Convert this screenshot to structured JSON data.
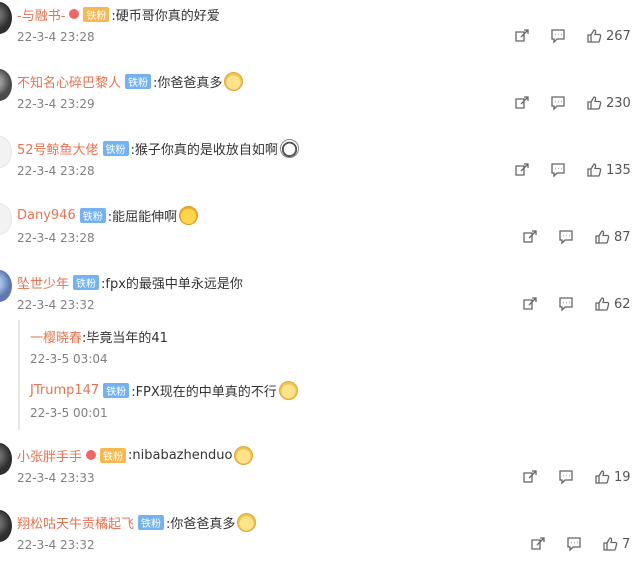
{
  "colors": {
    "username": "#eb7350",
    "badge": "#75b2f3",
    "time": "#808080",
    "text": "#333333"
  },
  "icons": {
    "repost": "repost-icon",
    "comment": "comment-icon",
    "like": "like-icon"
  },
  "comments": [
    {
      "user": "-与融书-",
      "badge": "铁粉",
      "text": ":硬币哥你真的好爱",
      "emoji": "",
      "time": "22-3-4 23:28",
      "likes": "267"
    },
    {
      "user": "不知名心碎巴黎人",
      "badge": "铁粉",
      "text": ":你爸爸真多",
      "emoji": "cat-emoji",
      "time": "22-3-4 23:29",
      "likes": "230"
    },
    {
      "user": "52号鲸鱼大佬",
      "badge": "铁粉",
      "text": ":猴子你真的是收放自如啊",
      "emoji": "dog-emoji",
      "time": "22-3-4 23:28",
      "likes": "135"
    },
    {
      "user": "Dany946",
      "badge": "铁粉",
      "text": ":能屈能伸啊",
      "emoji": "laugh-emoji",
      "time": "22-3-4 23:28",
      "likes": "87"
    },
    {
      "user": "坠世少年",
      "badge": "铁粉",
      "text": ":fpx的最强中单永远是你",
      "emoji": "",
      "time": "22-3-4 23:32",
      "likes": "62"
    },
    {
      "user": "小张胖手手",
      "badge": "铁粉",
      "text": ":nibabazhenduo",
      "emoji": "cat-emoji",
      "time": "22-3-4 23:33",
      "likes": "19"
    },
    {
      "user": "翔松咕天牛贡橘起飞",
      "badge": "铁粉",
      "text": ":你爸爸真多",
      "emoji": "cat-emoji",
      "time": "22-3-4 23:32",
      "likes": "7"
    }
  ],
  "replies": [
    {
      "user": "一樱晓春",
      "badge": "",
      "text": ":毕竟当年的41",
      "emoji": "",
      "time": "22-3-5 03:04"
    },
    {
      "user": "JTrump147",
      "badge": "铁粉",
      "text": ":FPX现在的中单真的不行",
      "emoji": "cat-emoji",
      "time": "22-3-5 00:01"
    }
  ]
}
